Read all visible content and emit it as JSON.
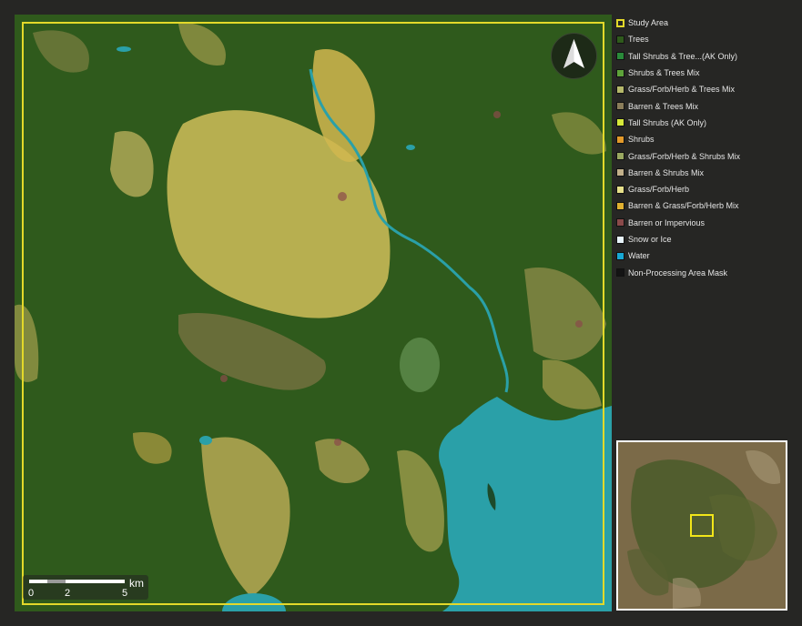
{
  "map": {
    "scale_bar": {
      "labels": [
        "0",
        "2",
        "5"
      ],
      "unit": "km"
    },
    "north_arrow_icon": "north-arrow-icon"
  },
  "legend": {
    "items": [
      {
        "label": "Study Area",
        "color": "#262624",
        "outline": "#e3d92a"
      },
      {
        "label": "Trees",
        "color": "#2f5a1c"
      },
      {
        "label": "Tall Shrubs & Tree...(AK Only)",
        "color": "#2a8a3a"
      },
      {
        "label": "Shrubs & Trees Mix",
        "color": "#5ea33a"
      },
      {
        "label": "Grass/Forb/Herb & Trees Mix",
        "color": "#b5b86a"
      },
      {
        "label": "Barren & Trees Mix",
        "color": "#8a7d5a"
      },
      {
        "label": "Tall Shrubs (AK Only)",
        "color": "#d6e83a"
      },
      {
        "label": "Shrubs",
        "color": "#e39a2a"
      },
      {
        "label": "Grass/Forb/Herb & Shrubs Mix",
        "color": "#9aa860"
      },
      {
        "label": "Barren & Shrubs Mix",
        "color": "#c2b08a"
      },
      {
        "label": "Grass/Forb/Herb",
        "color": "#e6e08a"
      },
      {
        "label": "Barren & Grass/Forb/Herb Mix",
        "color": "#e0b030"
      },
      {
        "label": "Barren or Impervious",
        "color": "#8a4a4a"
      },
      {
        "label": "Snow or Ice",
        "color": "#e8f4fb"
      },
      {
        "label": "Water",
        "color": "#18a8d4"
      },
      {
        "label": "Non-Processing Area Mask",
        "color": "#141414"
      }
    ]
  },
  "colors": {
    "trees": "#2f5a1c",
    "water": "#2aa0a8",
    "study_area_outline": "#e3d92a",
    "background": "#262624"
  }
}
